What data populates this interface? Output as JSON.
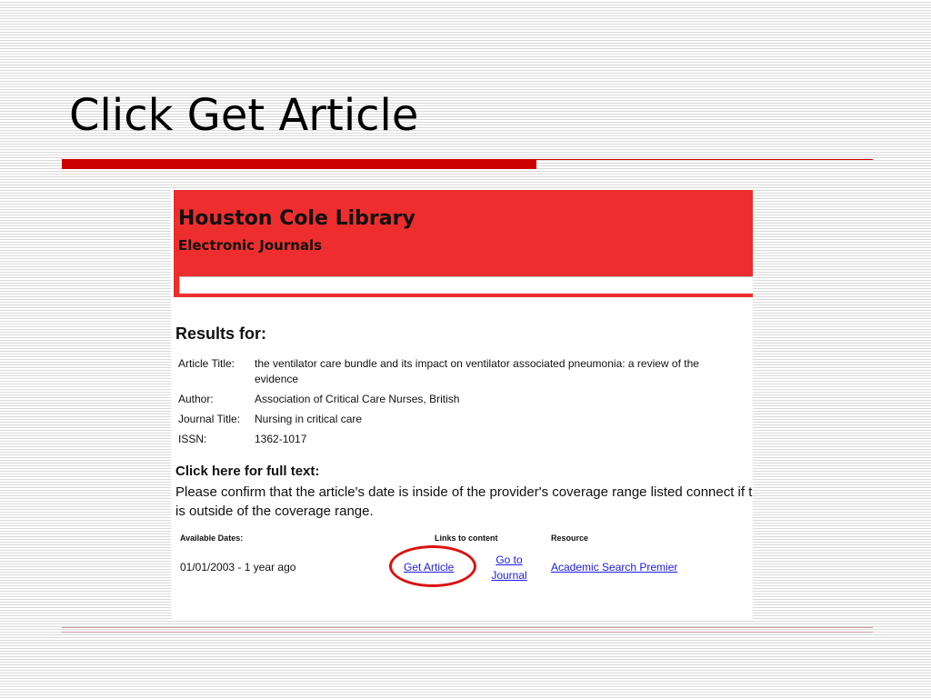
{
  "slide": {
    "title": "Click Get Article"
  },
  "library": {
    "name": "Houston Cole Library",
    "subtitle": "Electronic Journals",
    "search_value": ""
  },
  "results": {
    "heading": "Results for:",
    "fields": [
      {
        "label": "Article Title:",
        "value": "the ventilator care bundle and its impact on ventilator associated pneumonia: a review of the evidence"
      },
      {
        "label": "Author:",
        "value": "Association of Critical Care Nurses, British"
      },
      {
        "label": "Journal Title:",
        "value": "Nursing in critical care"
      },
      {
        "label": "ISSN:",
        "value": "1362-1017"
      }
    ]
  },
  "fulltext": {
    "heading": "Click here for full text:",
    "confirm_text": "Please confirm that the article's date is inside of the provider's coverage range listed connect if the article is outside of the coverage range.",
    "columns": {
      "dates": "Available Dates:",
      "links": "Links to content",
      "resource": "Resource"
    },
    "rows": [
      {
        "dates": "01/01/2003 - 1 year ago",
        "get_article": "Get Article",
        "go_to_journal": "Go to Journal",
        "resource": "Academic Search Premier"
      }
    ]
  },
  "colors": {
    "accent": "#cc0000",
    "header_red": "#ee2e2e",
    "link": "#1a1aee",
    "highlight": "#dd1111"
  }
}
